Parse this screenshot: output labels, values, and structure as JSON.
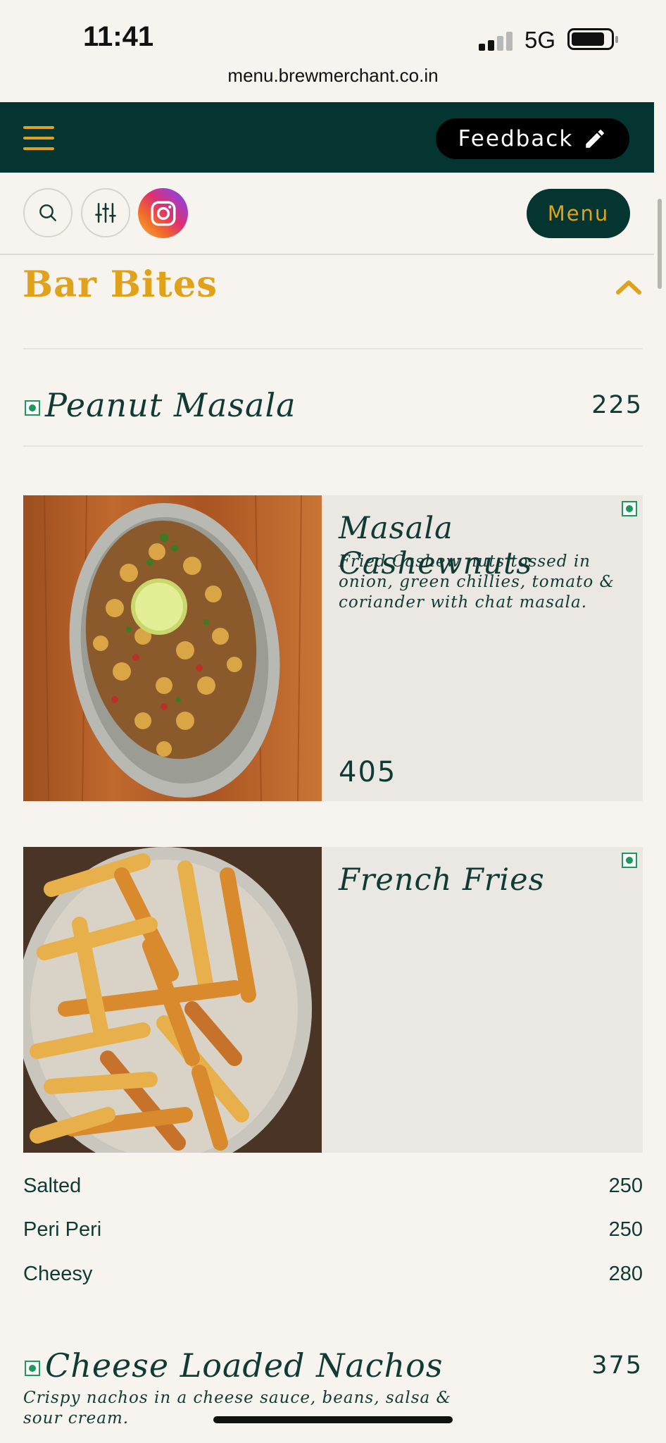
{
  "status_bar": {
    "time": "11:41",
    "network": "5G",
    "url": "menu.brewmerchant.co.in"
  },
  "header": {
    "feedback_label": "Feedback",
    "menu_label": "Menu",
    "icons": [
      "menu-icon",
      "pencil-icon",
      "search-icon",
      "filter-icon",
      "instagram-icon"
    ]
  },
  "section": {
    "title": "Bar Bites",
    "state": "expanded"
  },
  "items": [
    {
      "name": "Peanut Masala",
      "price": "225",
      "veg": true
    },
    {
      "name": "Masala Cashewnuts",
      "description": "Fried Cashew nuts tossed in onion, green chillies, tomato & coriander with chat masala.",
      "price": "405",
      "veg": true
    },
    {
      "name": "French Fries",
      "veg": true,
      "variants": [
        {
          "name": "Salted",
          "price": "250"
        },
        {
          "name": "Peri Peri",
          "price": "250"
        },
        {
          "name": "Cheesy",
          "price": "280"
        }
      ]
    },
    {
      "name": "Cheese Loaded Nachos",
      "description": "Crispy nachos in a cheese sauce, beans, salsa & sour cream.",
      "price": "375",
      "veg": true
    }
  ],
  "colors": {
    "brand_dark": "#043530",
    "accent": "#e0a21a",
    "background": "#f7f4ef",
    "card": "#ebe8e4",
    "veg": "#1d9a5b"
  }
}
